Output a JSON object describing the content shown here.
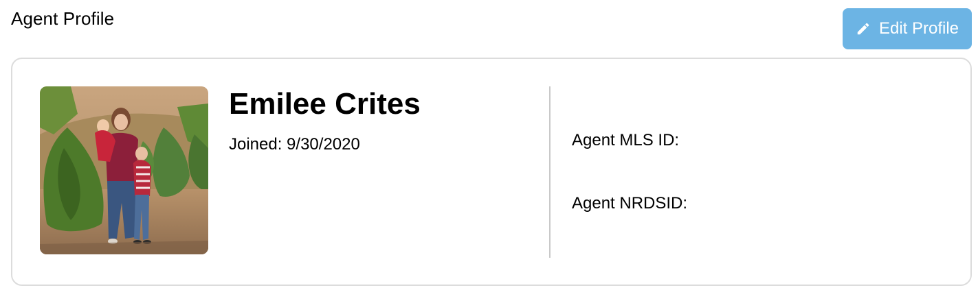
{
  "page": {
    "title": "Agent Profile"
  },
  "toolbar": {
    "edit_label": "Edit Profile",
    "edit_icon": "pencil-icon",
    "accent_color": "#6cb4e4"
  },
  "profile": {
    "name": "Emilee Crites",
    "joined": "Joined: 9/30/2020",
    "photo_alt": "agent-photo",
    "mls_id_label": "Agent MLS ID:",
    "mls_id_value": "",
    "nrdsid_label": "Agent NRDSID:",
    "nrdsid_value": ""
  }
}
